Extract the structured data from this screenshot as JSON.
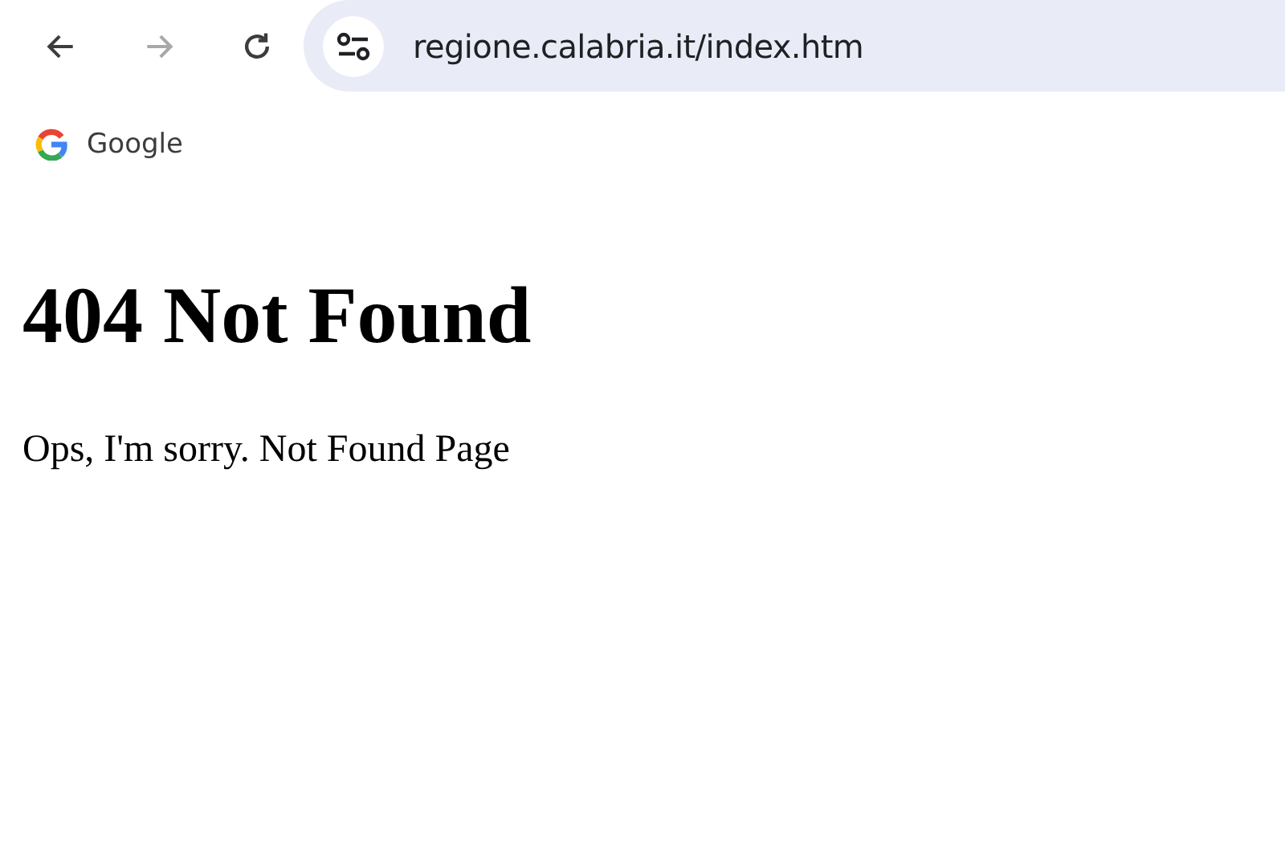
{
  "toolbar": {
    "buttons": [
      {
        "kind": "back",
        "disabled": false
      },
      {
        "kind": "forward",
        "disabled": true
      },
      {
        "kind": "reload",
        "disabled": false
      }
    ],
    "address": "regione.calabria.it/index.htm"
  },
  "bookmarks": [
    {
      "label": "Google"
    }
  ],
  "page": {
    "heading": "404 Not Found",
    "message": "Ops, I'm sorry. Not Found Page"
  }
}
